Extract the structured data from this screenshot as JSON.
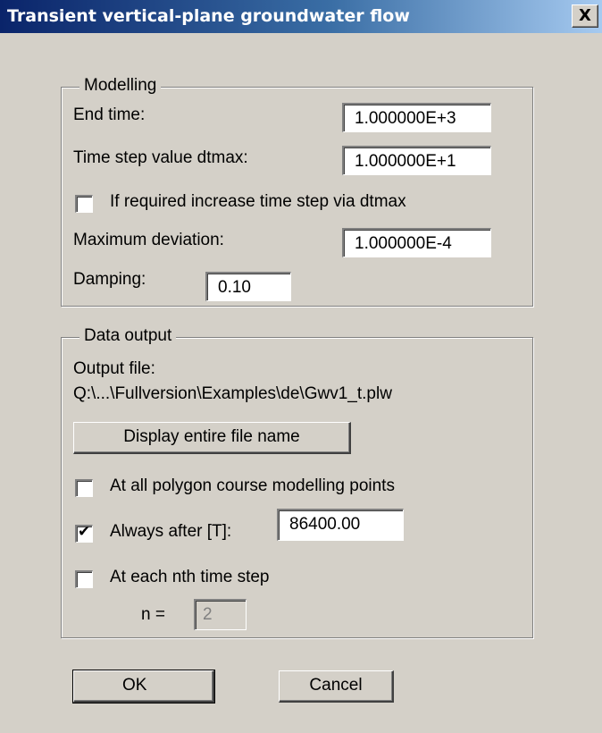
{
  "window": {
    "title": "Transient vertical-plane groundwater flow",
    "close_glyph": "X"
  },
  "modelling": {
    "legend": "Modelling",
    "end_time_label": "End time:",
    "end_time_value": "1.000000E+3",
    "time_step_label": "Time step value dtmax:",
    "time_step_value": "1.000000E+1",
    "increase_step_label": "If required increase time step via dtmax",
    "increase_step_checked": false,
    "max_deviation_label": "Maximum deviation:",
    "max_deviation_value": "1.000000E-4",
    "damping_label": "Damping:",
    "damping_value": "0.10"
  },
  "data_output": {
    "legend": "Data output",
    "output_file_label": "Output file:",
    "output_file_path": "Q:\\...\\Fullversion\\Examples\\de\\Gwv1_t.plw",
    "display_name_button": "Display entire file name",
    "all_points_label": "At all polygon course modelling points",
    "all_points_checked": false,
    "always_after_label": "Always after [T]:",
    "always_after_checked": true,
    "always_after_value": "86400.00",
    "nth_step_label": "At each nth time step",
    "nth_step_checked": false,
    "n_label": "n =",
    "n_value": "2"
  },
  "buttons": {
    "ok": "OK",
    "cancel": "Cancel"
  },
  "icons": {
    "check_mark": "✔"
  },
  "colors": {
    "title_bar": "#0a246a",
    "dialog_face": "#d4d0c8"
  }
}
